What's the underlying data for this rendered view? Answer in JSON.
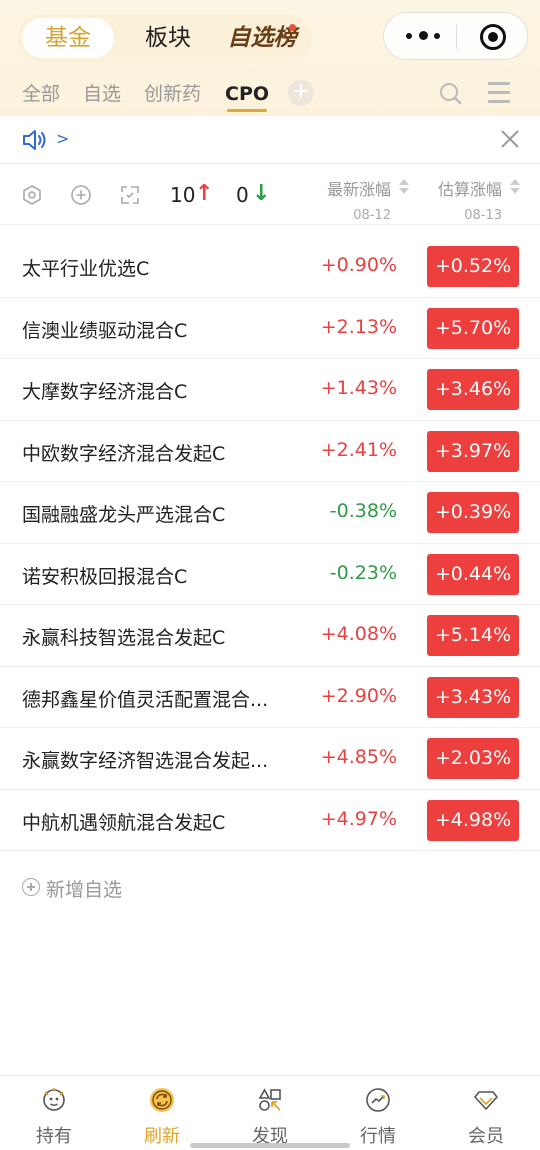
{
  "header": {
    "main_tabs": [
      {
        "label": "基金"
      },
      {
        "label": "板块"
      },
      {
        "label": "自选榜"
      }
    ],
    "sub_tabs": [
      {
        "label": "全部"
      },
      {
        "label": "自选"
      },
      {
        "label": "创新药"
      },
      {
        "label": "CPO"
      }
    ],
    "add_tab_label": "+"
  },
  "notice": {
    "arrow": ">"
  },
  "toolbar": {
    "up_count": "10",
    "up_arrow": "↑",
    "down_count": "0",
    "down_arrow": "↓",
    "latest_header": "最新涨幅",
    "latest_date": "08-12",
    "estimate_header": "估算涨幅",
    "estimate_date": "08-13"
  },
  "funds": [
    {
      "name": "太平行业优选C",
      "latest": "+0.90%",
      "estimate": "+0.52%"
    },
    {
      "name": "信澳业绩驱动混合C",
      "latest": "+2.13%",
      "estimate": "+5.70%"
    },
    {
      "name": "大摩数字经济混合C",
      "latest": "+1.43%",
      "estimate": "+3.46%"
    },
    {
      "name": "中欧数字经济混合发起C",
      "latest": "+2.41%",
      "estimate": "+3.97%"
    },
    {
      "name": "国融融盛龙头严选混合C",
      "latest": "-0.38%",
      "estimate": "+0.39%"
    },
    {
      "name": "诺安积极回报混合C",
      "latest": "-0.23%",
      "estimate": "+0.44%"
    },
    {
      "name": "永赢科技智选混合发起C",
      "latest": "+4.08%",
      "estimate": "+5.14%"
    },
    {
      "name": "德邦鑫星价值灵活配置混合...",
      "latest": "+2.90%",
      "estimate": "+3.43%"
    },
    {
      "name": "永赢数字经济智选混合发起...",
      "latest": "+4.85%",
      "estimate": "+2.03%"
    },
    {
      "name": "中航机遇领航混合发起C",
      "latest": "+4.97%",
      "estimate": "+4.98%"
    }
  ],
  "add_favorite_label": "新增自选",
  "bottom_nav": [
    {
      "label": "持有"
    },
    {
      "label": "刷新"
    },
    {
      "label": "发现"
    },
    {
      "label": "行情"
    },
    {
      "label": "会员"
    }
  ],
  "colors": {
    "up": "#e84141",
    "down": "#2e9b45",
    "accent": "#e2a32c",
    "estimate_bg": "#ee3f3f"
  }
}
